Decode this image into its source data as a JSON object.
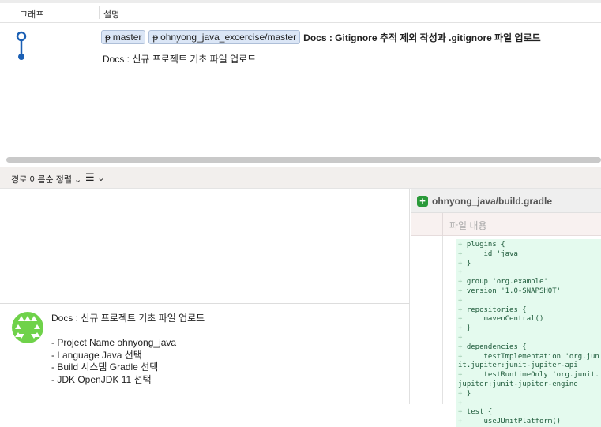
{
  "columns": {
    "graph": "그래프",
    "description": "설명"
  },
  "commit": {
    "branches": [
      "master",
      "ohnyong_java_excercise/master"
    ],
    "subject": "Docs : Gitignore 추적 제외 작성과 .gitignore 파일 업로드",
    "parent_subject": "Docs : 신규 프로젝트 기초 파일 업로드"
  },
  "toolbar": {
    "sort_label": "경로 이름순 정렬",
    "list_icon": "☰"
  },
  "message": {
    "lines": [
      "Docs : 신규 프로젝트 기초 파일 업로드",
      "",
      "- Project Name ohnyong_java",
      "- Language Java 선택",
      "- Build 시스템 Gradle 선택",
      "- JDK OpenJDK 11 선택"
    ]
  },
  "file": {
    "path": "ohnyong_java/build.gradle",
    "content_label": "파일 내용",
    "lines": [
      "plugins {",
      "    id 'java'",
      "}",
      "",
      "group 'org.example'",
      "version '1.0-SNAPSHOT'",
      "",
      "repositories {",
      "    mavenCentral()",
      "}",
      "",
      "dependencies {",
      "    testImplementation 'org.junit.jupiter:junit-jupiter-api'",
      "    testRuntimeOnly 'org.junit.jupiter:junit-jupiter-engine'",
      "}",
      "",
      "test {",
      "    useJUnitPlatform()"
    ]
  },
  "colors": {
    "accent": "#1a5fb4",
    "added": "#e4faee"
  }
}
